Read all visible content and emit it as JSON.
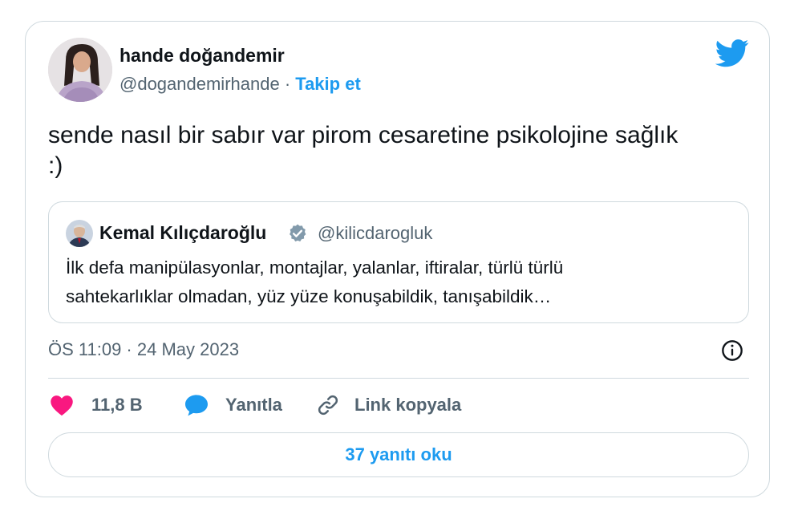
{
  "author": {
    "name": "hande doğandemir",
    "handle": "@dogandemirhande",
    "separator": " · ",
    "follow_label": "Takip et"
  },
  "tweet": {
    "text_line1": "sende nasıl bir sabır var pirom cesaretine psikolojine sağlık",
    "text_line2": ":)",
    "timestamp": "ÖS 11:09 · 24 May 2023"
  },
  "quoted_tweet": {
    "name": "Kemal Kılıçdaroğlu",
    "verified": true,
    "handle": "@kilicdarogluk",
    "text_line1": "İlk defa manipülasyonlar, montajlar, yalanlar, iftiralar, türlü türlü",
    "text_line2": "sahtekarlıklar olmadan, yüz yüze konuşabildik, tanışabildik…"
  },
  "actions": {
    "like_count": "11,8 B",
    "reply_label": "Yanıtla",
    "copy_link_label": "Link kopyala"
  },
  "read_replies_label": "37 yanıtı oku",
  "icons": {
    "brand": "twitter-bird-icon",
    "like": "heart-icon",
    "reply": "speech-bubble-icon",
    "copy": "link-icon",
    "info": "info-icon",
    "verified": "verified-badge-icon"
  },
  "colors": {
    "accent": "#1d9bf0",
    "like": "#f91880",
    "verified_badge": "#829aab",
    "secondary_text": "#536471",
    "border": "#cfd9de"
  }
}
